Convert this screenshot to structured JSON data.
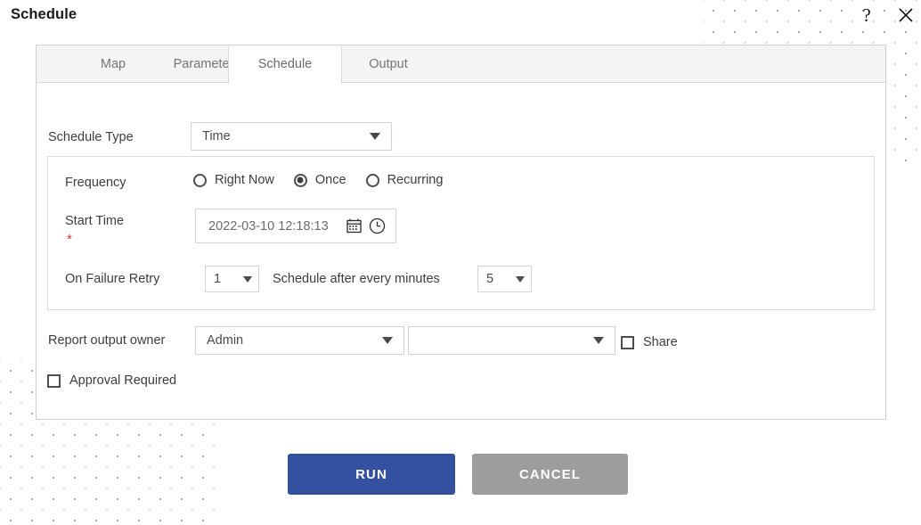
{
  "window": {
    "title": "Schedule",
    "help_icon": "question-mark-icon",
    "close_icon": "close-icon"
  },
  "tabs": [
    {
      "label": "Map",
      "active": false
    },
    {
      "label": "Parameter",
      "active": false
    },
    {
      "label": "Schedule",
      "active": true
    },
    {
      "label": "Output",
      "active": false
    }
  ],
  "form": {
    "schedule_type_label": "Schedule Type",
    "schedule_type_value": "Time",
    "frequency_label": "Frequency",
    "frequency_options": [
      {
        "label": "Right Now",
        "selected": false
      },
      {
        "label": "Once",
        "selected": true
      },
      {
        "label": "Recurring",
        "selected": false
      }
    ],
    "start_time_label": "Start Time",
    "start_time_required": "*",
    "start_time_value": "2022-03-10 12:18:13",
    "calendar_icon": "calendar-icon",
    "clock_icon": "clock-icon",
    "on_failure_retry_label": "On Failure Retry",
    "retry_count_value": "1",
    "schedule_after_label": "Schedule after every minutes",
    "minutes_value": "5",
    "report_owner_label": "Report output owner",
    "report_owner_value": "Admin",
    "secondary_owner_value": "",
    "share_label": "Share",
    "share_checked": false,
    "approval_label": "Approval Required",
    "approval_checked": false
  },
  "footer": {
    "run_label": "RUN",
    "cancel_label": "CANCEL"
  },
  "colors": {
    "run_button": "#3450a0",
    "cancel_button": "#9d9d9d",
    "required_star": "#e03030",
    "tab_bar": "#f4f4f4",
    "dot_pattern": "#9aa6d8"
  }
}
